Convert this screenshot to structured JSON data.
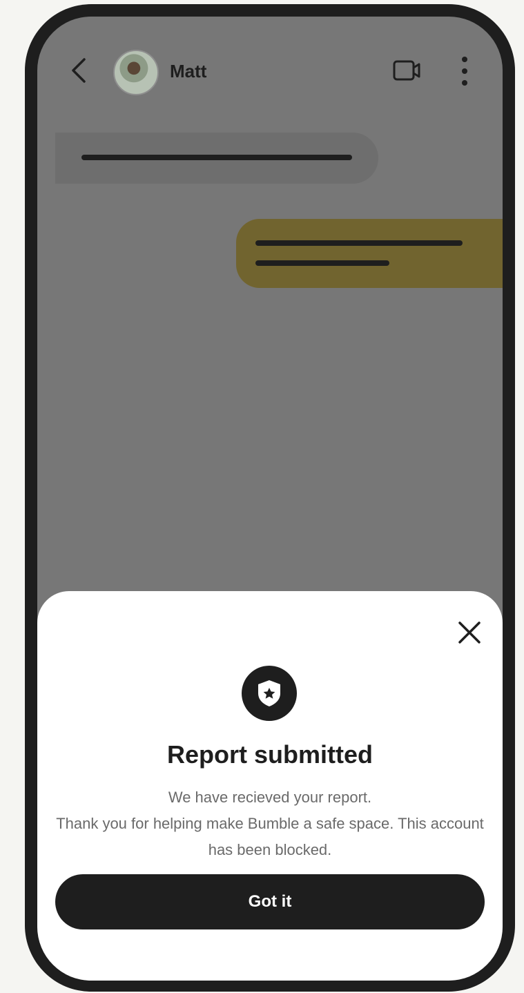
{
  "header": {
    "contact_name": "Matt",
    "icons": {
      "back": "chevron-left-icon",
      "video": "video-camera-icon",
      "more": "more-vertical-icon"
    }
  },
  "messages": [
    {
      "direction": "incoming",
      "content": ""
    },
    {
      "direction": "outgoing",
      "content": ""
    }
  ],
  "dialog": {
    "icon": "shield-star-icon",
    "title": "Report submitted",
    "lines": [
      "We have recieved your report.",
      "Thank you for helping make Bumble a safe space. This account has been blocked."
    ],
    "button_label": "Got it"
  },
  "colors": {
    "overlay": "#777777",
    "outgoing_bubble": "#71642f",
    "button": "#1e1e1e",
    "frame": "#1e1e1e"
  }
}
